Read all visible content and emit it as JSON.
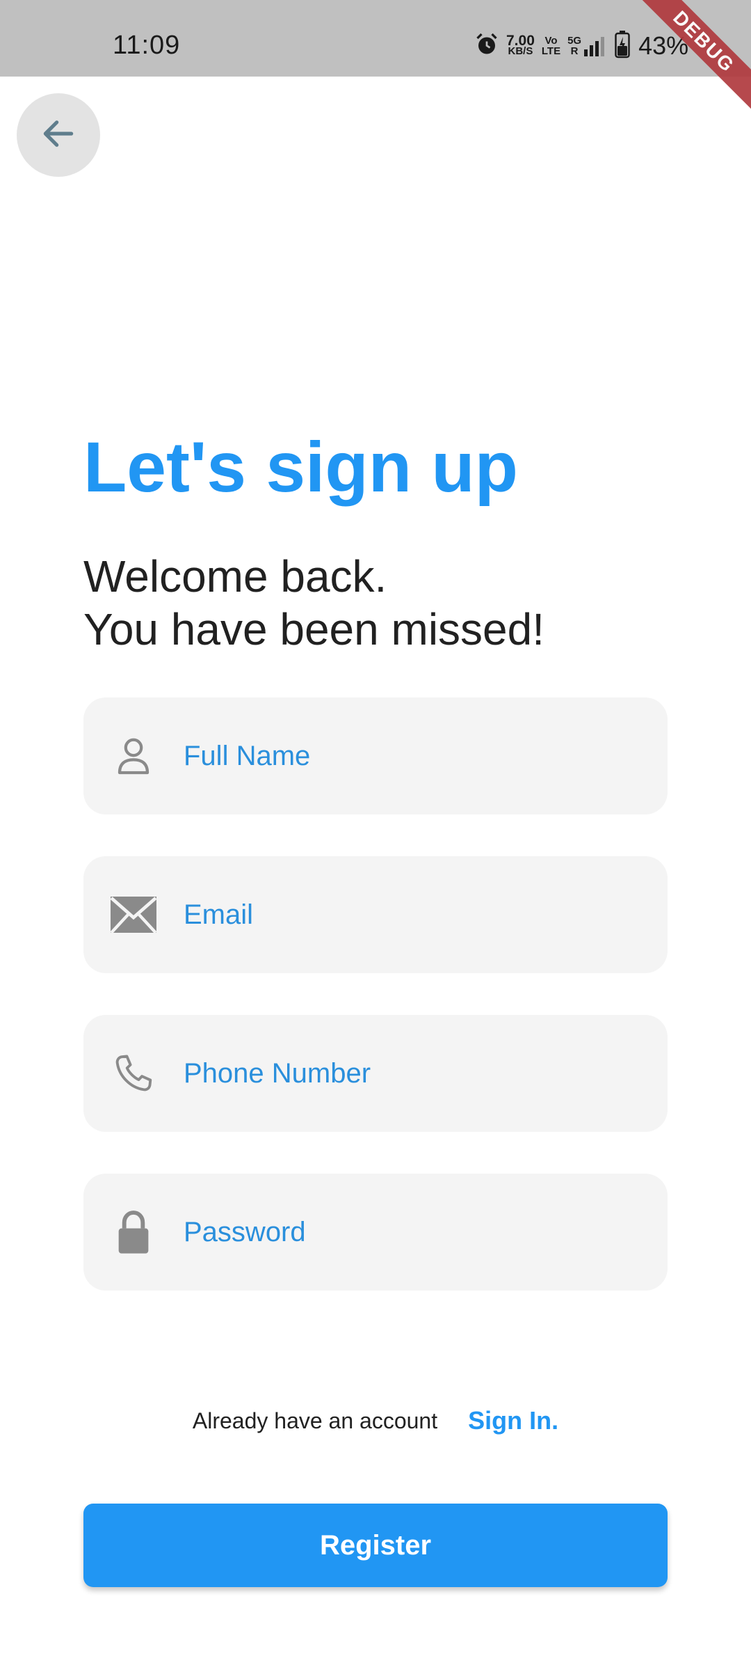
{
  "status_bar": {
    "time": "11:09",
    "network_speed_value": "7.00",
    "network_speed_unit": "KB/S",
    "volte_top": "Vo",
    "volte_bottom": "LTE",
    "network_type": "5G",
    "network_sub": "R",
    "battery_percent": "43%"
  },
  "debug_banner": "DEBUG",
  "title": "Let's sign up",
  "subtitle": {
    "line1": "Welcome back.",
    "line2": "You have been missed!"
  },
  "fields": {
    "full_name": {
      "placeholder": "Full Name",
      "value": ""
    },
    "email": {
      "placeholder": "Email",
      "value": ""
    },
    "phone": {
      "placeholder": "Phone Number",
      "value": ""
    },
    "password": {
      "placeholder": "Password",
      "value": ""
    }
  },
  "signin": {
    "prompt": "Already have an account",
    "link": "Sign In."
  },
  "register_label": "Register",
  "colors": {
    "accent": "#2196f3",
    "field_bg": "#f4f4f4",
    "status_bar_bg": "#c0c0c0",
    "debug_ribbon": "#b03a3e",
    "icon_gray": "#8a8a8a"
  }
}
